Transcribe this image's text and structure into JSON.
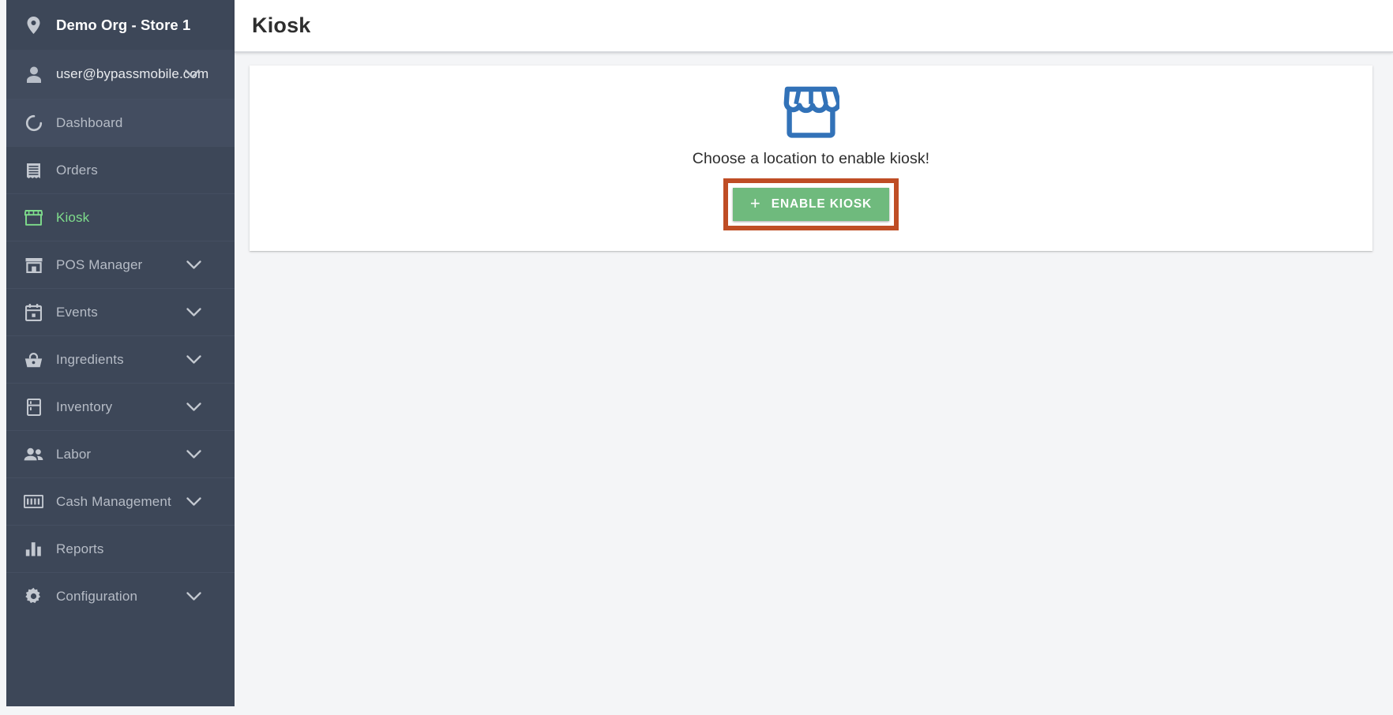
{
  "sidebar": {
    "org": {
      "label": "Demo Org - Store 1",
      "icon": "location-pin-icon"
    },
    "user": {
      "email": "user@bypassmobile.com",
      "icon": "person-icon",
      "chevron": "chevron-down-icon"
    },
    "active_item": "Kiosk",
    "active_color": "#7fdd8c",
    "background_color": "#3d4758",
    "items": [
      {
        "label": "Dashboard",
        "icon": "dashboard-ring-icon",
        "has_submenu": false,
        "active": false,
        "hovered": true
      },
      {
        "label": "Orders",
        "icon": "receipt-icon",
        "has_submenu": false,
        "active": false,
        "hovered": false
      },
      {
        "label": "Kiosk",
        "icon": "storefront-icon",
        "has_submenu": false,
        "active": true,
        "hovered": false
      },
      {
        "label": "POS Manager",
        "icon": "pos-terminal-icon",
        "has_submenu": true,
        "active": false,
        "hovered": false
      },
      {
        "label": "Events",
        "icon": "calendar-icon",
        "has_submenu": true,
        "active": false,
        "hovered": false
      },
      {
        "label": "Ingredients",
        "icon": "basket-icon",
        "has_submenu": true,
        "active": false,
        "hovered": false
      },
      {
        "label": "Inventory",
        "icon": "fridge-icon",
        "has_submenu": true,
        "active": false,
        "hovered": false
      },
      {
        "label": "Labor",
        "icon": "people-icon",
        "has_submenu": true,
        "active": false,
        "hovered": false
      },
      {
        "label": "Cash Management",
        "icon": "banknote-100-icon",
        "has_submenu": true,
        "active": false,
        "hovered": false
      },
      {
        "label": "Reports",
        "icon": "bar-chart-icon",
        "has_submenu": false,
        "active": false,
        "hovered": false
      },
      {
        "label": "Configuration",
        "icon": "gear-icon",
        "has_submenu": true,
        "active": false,
        "hovered": false
      }
    ]
  },
  "header": {
    "title": "Kiosk"
  },
  "main": {
    "hero_icon": "storefront-icon",
    "hero_icon_color": "#3272b8",
    "message": "Choose a location to enable kiosk!",
    "enable_button": {
      "label": "ENABLE KIOSK",
      "plus": "+",
      "color": "#6fba7d",
      "highlight_border_color": "#bf4d25"
    }
  }
}
